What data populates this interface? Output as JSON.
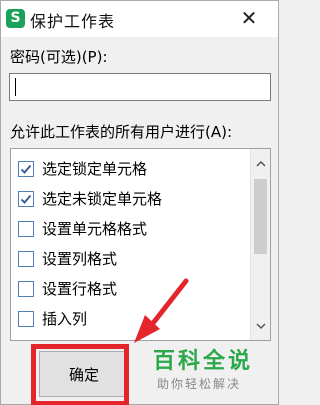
{
  "window": {
    "app_icon_letter": "S",
    "title": "保护工作表",
    "close_symbol": "✕"
  },
  "password": {
    "label": "密码(可选)(P):",
    "value": ""
  },
  "permissions": {
    "label": "允许此工作表的所有用户进行(A):",
    "items": [
      {
        "label": "选定锁定单元格",
        "checked": true
      },
      {
        "label": "选定未锁定单元格",
        "checked": true
      },
      {
        "label": "设置单元格格式",
        "checked": false
      },
      {
        "label": "设置列格式",
        "checked": false
      },
      {
        "label": "设置行格式",
        "checked": false
      },
      {
        "label": "插入列",
        "checked": false
      }
    ]
  },
  "buttons": {
    "ok_label": "确定"
  },
  "watermark": {
    "title": "百科全说",
    "subtitle": "助你轻松解决"
  },
  "colors": {
    "highlight": "#e4252b",
    "checkmark": "#2b5797",
    "watermark_green": "#2aa84a"
  }
}
